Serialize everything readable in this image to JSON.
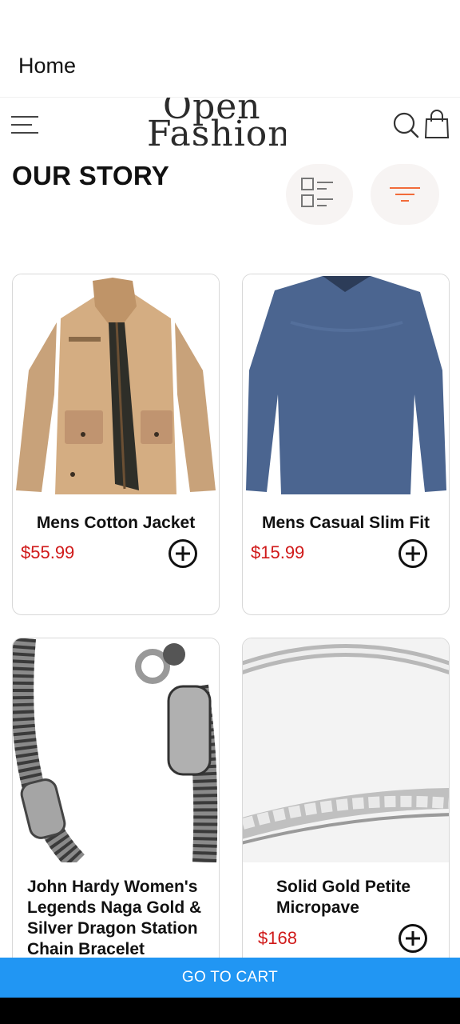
{
  "appbar": {
    "title": "Home"
  },
  "header": {
    "logo_line1": "Open",
    "logo_line2": "Fashion",
    "menu_icon": "menu-icon",
    "search_icon": "search-icon",
    "bag_icon": "shopping-bag-icon"
  },
  "story": {
    "title": "OUR STORY",
    "grid_icon": "list-view-icon",
    "filter_icon": "filter-icon",
    "filter_color": "#f26b3a"
  },
  "products": [
    {
      "name": "Mens Cotton Jacket",
      "price": "$55.99",
      "image": "tan-cotton-jacket"
    },
    {
      "name": "Mens Casual Slim Fit",
      "price": "$15.99",
      "image": "blue-long-sleeve-shirt"
    },
    {
      "name": "John Hardy Women's Legends Naga Gold & Silver Dragon Station Chain Bracelet",
      "price": "",
      "image": "silver-dragon-chain-bracelet"
    },
    {
      "name": "Solid Gold Petite Micropave",
      "price": "$168",
      "image": "diamond-ring"
    }
  ],
  "cart": {
    "label": "GO TO CART",
    "color": "#2196f3"
  },
  "colors": {
    "price": "#d01a1a",
    "accent": "#f26b3a"
  }
}
